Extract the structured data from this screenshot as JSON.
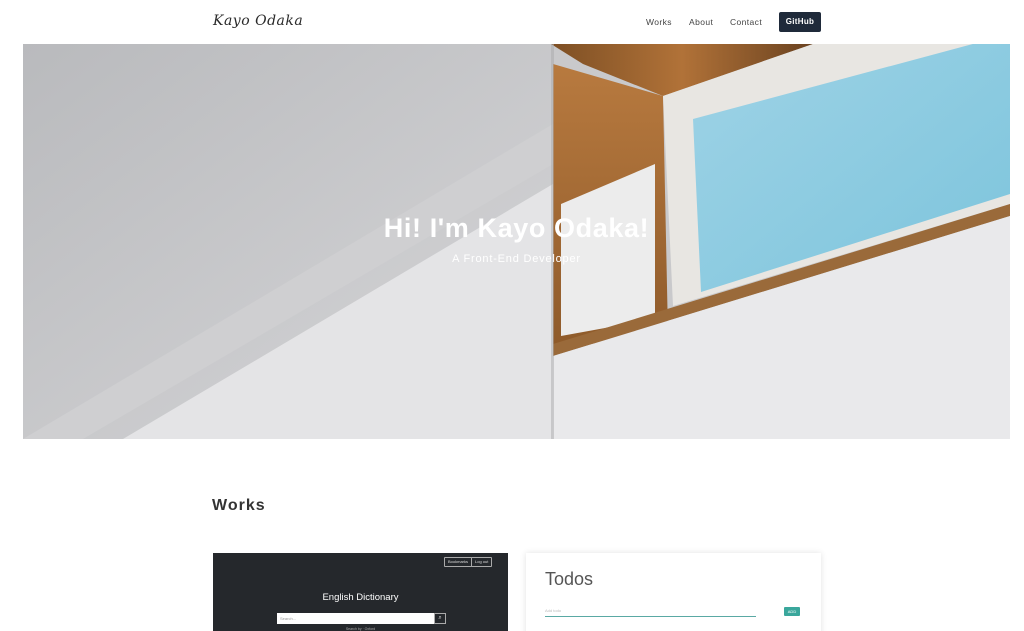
{
  "header": {
    "logo": "Kayo Odaka",
    "nav": [
      "Works",
      "About",
      "Contact"
    ],
    "github_label": "GitHub"
  },
  "hero": {
    "title": "Hi! I'm Kayo Odaka!",
    "subtitle": "A Front-End Developer"
  },
  "works": {
    "heading": "Works",
    "cards": [
      {
        "name": "English Dictionary",
        "buttons": [
          "Bookmarks",
          "Log out"
        ],
        "search_placeholder": "Search...",
        "footer": "Search by · Oxford"
      },
      {
        "name": "Todos",
        "input_placeholder": "Add todo",
        "add_label": "ADD"
      }
    ]
  },
  "colors": {
    "github_button": "#1f2a3a",
    "todo_accent": "#3aa79c",
    "dict_background": "#25282c"
  },
  "icons": {
    "dict_search": "search-icon"
  }
}
